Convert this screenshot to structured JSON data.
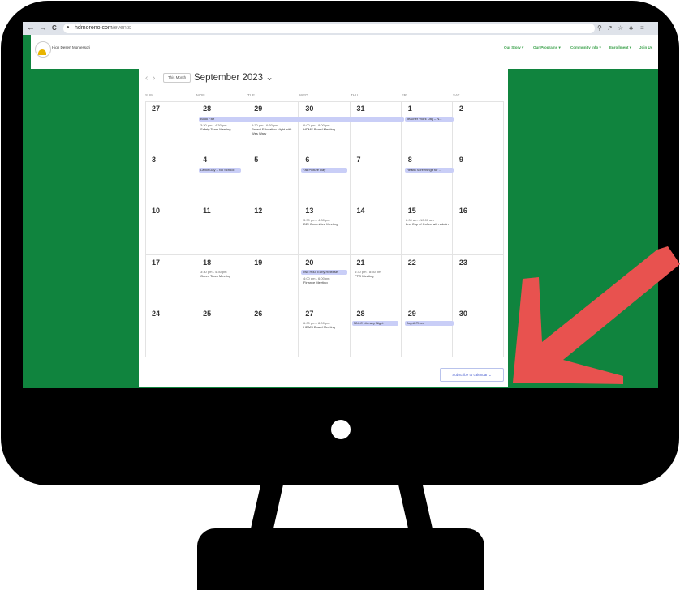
{
  "browser": {
    "url_domain": "hdmoreno.com",
    "url_path": "/events",
    "back_glyph": "←",
    "forward_glyph": "→",
    "reload_glyph": "C",
    "lock_glyph": "🔒",
    "right_icons": [
      "search-icon",
      "share-icon",
      "star-icon",
      "extensions-icon",
      "menu-icon"
    ]
  },
  "site": {
    "name": "High Desert Montessori",
    "menu": [
      "Our Story ▾",
      "Our Programs ▾",
      "Community Info ▾",
      "Enrollment ▾",
      "Join Us"
    ]
  },
  "calendar": {
    "this_month_label": "This Month",
    "month_title": "September 2023 ⌄",
    "weekdays": [
      "SUN",
      "MON",
      "TUE",
      "WED",
      "THU",
      "FRI",
      "SAT"
    ],
    "day_numbers": [
      [
        "27",
        "28",
        "29",
        "30",
        "31",
        "1",
        "2"
      ],
      [
        "3",
        "4",
        "5",
        "6",
        "7",
        "8",
        "9"
      ],
      [
        "10",
        "11",
        "12",
        "13",
        "14",
        "15",
        "16"
      ],
      [
        "17",
        "18",
        "19",
        "20",
        "21",
        "22",
        "23"
      ],
      [
        "24",
        "25",
        "26",
        "27",
        "28",
        "29",
        "30"
      ]
    ],
    "events": {
      "book_fair": "Book Fair",
      "teacher_work_day": "Teacher Work Day – N...",
      "safety_time": "3:30 pm - 4:30 pm",
      "safety_title": "Safety Team Meeting",
      "parent_ed_time": "5:30 pm - 6:30 pm",
      "parent_ed_title": "Parent Education Night with Wes Wary",
      "hdms_board_time": "6:00 pm - 8:00 pm",
      "hdms_board_title": "HDMS Board Meeting",
      "labor_day": "Labor Day – No School",
      "fall_picture": "Fall Picture Day",
      "health_screenings": "Health Screenings for ...",
      "dei_time": "3:30 pm - 4:30 pm",
      "dei_title": "DEI Committee Meeting",
      "coffee_time": "8:00 am - 10:00 am",
      "coffee_title": "2nd Cup of Coffee with admin",
      "green_time": "3:30 pm - 4:30 pm",
      "green_title": "Green Team Meeting",
      "early_release": "Two Hour Early Release",
      "finance_time": "4:00 pm - 6:00 pm",
      "finance_title": "Finance Meeting",
      "pto_time": "6:30 pm - 8:30 pm",
      "pto_title": "PTO Meeting",
      "board27_time": "6:00 pm - 8:00 pm",
      "board27_title": "HDMS Board Meeting",
      "literacy_night": "NNLC Literacy Night",
      "jog_a_thon": "Jog-A-Thon"
    },
    "subscribe_label": "Subscribe to calendar ⌄"
  },
  "colors": {
    "screen_green": "#10843e",
    "event_bar": "#c9cef7",
    "arrow_red": "#e8524f",
    "menu_green": "#3aa14a"
  }
}
